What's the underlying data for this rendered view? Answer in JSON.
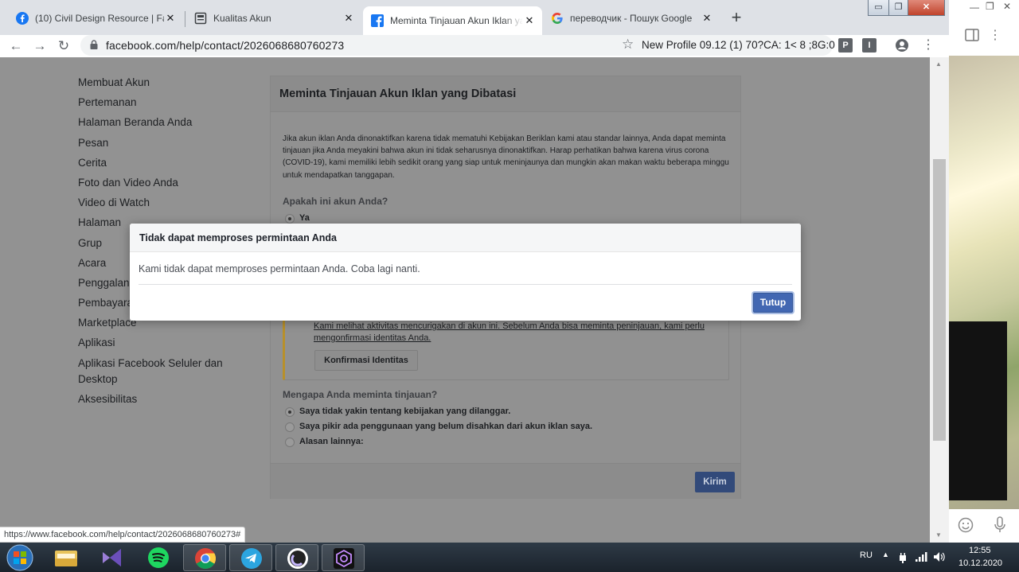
{
  "browser": {
    "tabs": [
      {
        "label": "(10) Civil Design Resource | Faceb",
        "icon": "facebook-icon"
      },
      {
        "label": "Kualitas Akun",
        "icon": "page-icon"
      },
      {
        "label": "Meminta Tinjauan Akun Iklan yan",
        "icon": "facebook-icon",
        "active": true
      },
      {
        "label": "переводчик - Пошук Google",
        "icon": "google-icon"
      }
    ],
    "url": "facebook.com/help/contact/2026068680760273",
    "profile_text": "New Profile 09.12 (1) 70?CA: 1< 8 ;8G:0",
    "ext_labels": [
      "P",
      "I"
    ],
    "status_url": "https://www.facebook.com/help/contact/2026068680760273#"
  },
  "sidebar": {
    "items": [
      "Membuat Akun",
      "Pertemanan",
      "Halaman Beranda Anda",
      "Pesan",
      "Cerita",
      "Foto dan Video Anda",
      "Video di Watch",
      "Halaman",
      "Grup",
      "Acara",
      "Penggalang",
      "Pembayara",
      "Marketplace",
      "Aplikasi",
      "Aplikasi Facebook Seluler dan Desktop",
      "Aksesibilitas"
    ]
  },
  "form": {
    "title": "Meminta Tinjauan Akun Iklan yang Dibatasi",
    "description": "Jika akun iklan Anda dinonaktifkan karena tidak mematuhi Kebijakan Beriklan kami atau standar lainnya, Anda dapat meminta tinjauan jika Anda meyakini bahwa akun ini tidak seharusnya dinonaktifkan. Harap perhatikan bahwa karena virus corona (COVID-19), kami memiliki lebih sedikit orang yang siap untuk meninjaunya dan mungkin akan makan waktu beberapa minggu untuk mendapatkan tanggapan.",
    "question_1": "Apakah ini akun Anda?",
    "answer_yes": "Ya",
    "warning_text": "Kami melihat aktivitas mencurigakan di akun ini. Sebelum Anda bisa meminta peninjauan, kami perlu mengonfirmasi identitas Anda.",
    "confirm_button": "Konfirmasi Identitas",
    "question_2": "Mengapa Anda meminta tinjauan?",
    "reasons": [
      "Saya tidak yakin tentang kebijakan yang dilanggar.",
      "Saya pikir ada penggunaan yang belum disahkan dari akun iklan saya.",
      "Alasan lainnya:"
    ],
    "submit_button": "Kirim"
  },
  "modal": {
    "title": "Tidak dapat memproses permintaan Anda",
    "body": "Kami tidak dapat memproses permintaan Anda. Coba lagi nanti.",
    "close_button": "Tutup"
  },
  "taskbar": {
    "language": "RU",
    "time": "12:55",
    "date": "10.12.2020"
  },
  "colors": {
    "facebook_blue": "#4267b2",
    "overlay_gray": "#929292"
  }
}
